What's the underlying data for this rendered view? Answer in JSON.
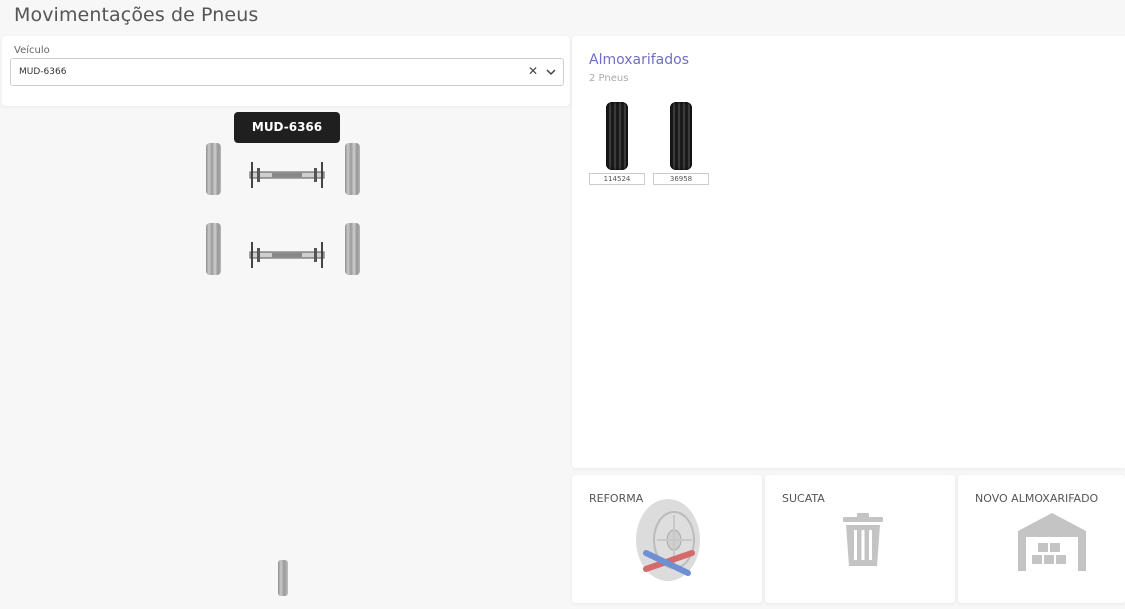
{
  "page": {
    "title": "Movimentações de Pneus"
  },
  "vehicle": {
    "label": "Veículo",
    "selected": "MUD-6366",
    "plate": "MUD-6366"
  },
  "stock": {
    "title": "Almoxarifados",
    "count_text": "2 Pneus",
    "tires": [
      {
        "id": "114524"
      },
      {
        "id": "36958"
      }
    ]
  },
  "actions": [
    {
      "label": "REFORMA",
      "icon": "tire-repair-icon"
    },
    {
      "label": "SUCATA",
      "icon": "trash-icon"
    },
    {
      "label": "NOVO ALMOXARIFADO",
      "icon": "warehouse-icon"
    }
  ],
  "colors": {
    "accent": "#6f6fc4",
    "background": "#f7f7f7",
    "badge": "#1f1f1f"
  }
}
